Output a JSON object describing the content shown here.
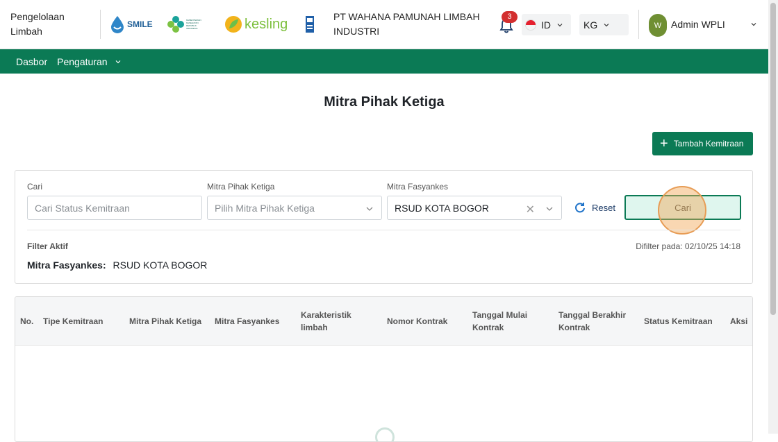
{
  "header": {
    "app_title": "Pengelolaan Limbah",
    "logos": {
      "smile": "SMILE",
      "kemenkes": "KEMENTERIAN KESEHATAN REPUBLIK INDONESIA",
      "kesling": "kesling"
    },
    "org_name": "PT WAHANA PAMUNAH LIMBAH INDUSTRI",
    "notification_count": "3",
    "language": "ID",
    "unit": "KG",
    "user_initial": "W",
    "user_name": "Admin WPLI"
  },
  "nav": {
    "items": [
      {
        "label": "Dasbor"
      },
      {
        "label": "Pengaturan"
      }
    ]
  },
  "page": {
    "title": "Mitra Pihak Ketiga",
    "add_button": "Tambah Kemitraan"
  },
  "filters": {
    "search": {
      "label": "Cari",
      "placeholder": "Cari Status Kemitraan"
    },
    "partner": {
      "label": "Mitra Pihak Ketiga",
      "placeholder": "Pilih Mitra Pihak Ketiga"
    },
    "facility": {
      "label": "Mitra Fasyankes",
      "value": "RSUD KOTA BOGOR"
    },
    "reset_label": "Reset",
    "search_button": "Cari",
    "active_title": "Filter Aktif",
    "filtered_at": "Difilter pada: 02/10/25 14:18",
    "active_filter_key": "Mitra Fasyankes:",
    "active_filter_value": "RSUD KOTA BOGOR"
  },
  "table": {
    "columns": [
      "No.",
      "Tipe Kemitraan",
      "Mitra Pihak Ketiga",
      "Mitra Fasyankes",
      "Karakteristik limbah",
      "Nomor Kontrak",
      "Tanggal Mulai Kontrak",
      "Tanggal Berakhir Kontrak",
      "Status Kemitraan",
      "Aksi"
    ]
  },
  "colors": {
    "primary": "#0b7a55",
    "badge": "#d32f2f",
    "avatar": "#6f8f33"
  }
}
